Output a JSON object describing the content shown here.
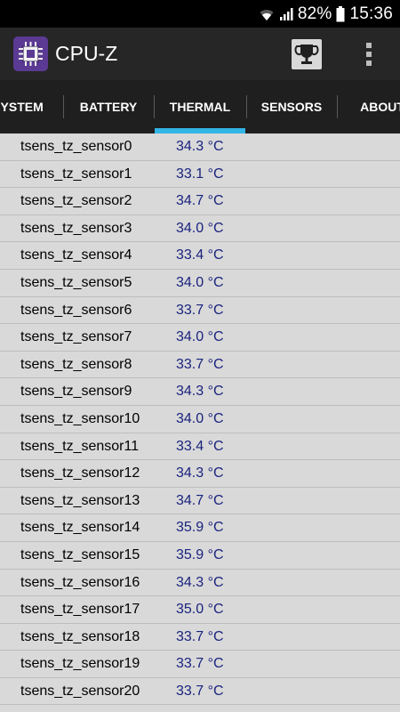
{
  "status_bar": {
    "battery_percent": "82%",
    "time": "15:36"
  },
  "app": {
    "title": "CPU-Z",
    "logo_icon": "chip-icon",
    "trophy_icon": "trophy-icon",
    "menu_icon": "overflow-menu-icon"
  },
  "tabs": [
    {
      "label": "SYSTEM"
    },
    {
      "label": "BATTERY"
    },
    {
      "label": "THERMAL",
      "selected": true
    },
    {
      "label": "SENSORS"
    },
    {
      "label": "ABOUT"
    }
  ],
  "colors": {
    "accent": "#33b5e5",
    "value_text": "#1a237e",
    "logo_bg": "#5b3a93"
  },
  "sensors": [
    {
      "name": "tsens_tz_sensor0",
      "value": "34.3 °C"
    },
    {
      "name": "tsens_tz_sensor1",
      "value": "33.1 °C"
    },
    {
      "name": "tsens_tz_sensor2",
      "value": "34.7 °C"
    },
    {
      "name": "tsens_tz_sensor3",
      "value": "34.0 °C"
    },
    {
      "name": "tsens_tz_sensor4",
      "value": "33.4 °C"
    },
    {
      "name": "tsens_tz_sensor5",
      "value": "34.0 °C"
    },
    {
      "name": "tsens_tz_sensor6",
      "value": "33.7 °C"
    },
    {
      "name": "tsens_tz_sensor7",
      "value": "34.0 °C"
    },
    {
      "name": "tsens_tz_sensor8",
      "value": "33.7 °C"
    },
    {
      "name": "tsens_tz_sensor9",
      "value": "34.3 °C"
    },
    {
      "name": "tsens_tz_sensor10",
      "value": "34.0 °C"
    },
    {
      "name": "tsens_tz_sensor11",
      "value": "33.4 °C"
    },
    {
      "name": "tsens_tz_sensor12",
      "value": "34.3 °C"
    },
    {
      "name": "tsens_tz_sensor13",
      "value": "34.7 °C"
    },
    {
      "name": "tsens_tz_sensor14",
      "value": "35.9 °C"
    },
    {
      "name": "tsens_tz_sensor15",
      "value": "35.9 °C"
    },
    {
      "name": "tsens_tz_sensor16",
      "value": "34.3 °C"
    },
    {
      "name": "tsens_tz_sensor17",
      "value": "35.0 °C"
    },
    {
      "name": "tsens_tz_sensor18",
      "value": "33.7 °C"
    },
    {
      "name": "tsens_tz_sensor19",
      "value": "33.7 °C"
    },
    {
      "name": "tsens_tz_sensor20",
      "value": "33.7 °C"
    }
  ]
}
